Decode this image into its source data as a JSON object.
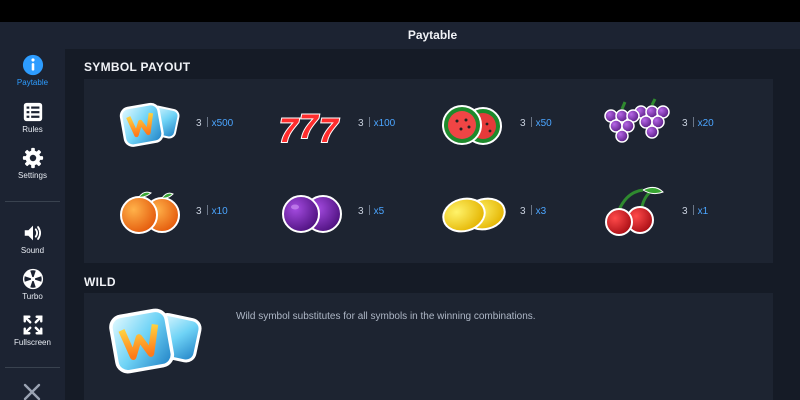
{
  "sidebar": {
    "items": [
      {
        "label": "Paytable",
        "icon": "info-icon",
        "active": true
      },
      {
        "label": "Rules",
        "icon": "list-icon"
      },
      {
        "label": "Settings",
        "icon": "gear-icon"
      },
      {
        "label": "Sound",
        "icon": "speaker-icon"
      },
      {
        "label": "Turbo",
        "icon": "turbo-icon"
      },
      {
        "label": "Fullscreen",
        "icon": "fullscreen-icon"
      }
    ],
    "close_icon": "close-icon"
  },
  "header": {
    "title": "Paytable"
  },
  "symbol_payout": {
    "title": "SYMBOL PAYOUT",
    "rows": [
      [
        {
          "symbol": "ice-wild-icon",
          "count": "3",
          "multiplier": "x500"
        },
        {
          "symbol": "sevens-icon",
          "count": "3",
          "multiplier": "x100"
        },
        {
          "symbol": "watermelon-icon",
          "count": "3",
          "multiplier": "x50"
        },
        {
          "symbol": "grapes-icon",
          "count": "3",
          "multiplier": "x20"
        }
      ],
      [
        {
          "symbol": "orange-icon",
          "count": "3",
          "multiplier": "x10"
        },
        {
          "symbol": "plum-icon",
          "count": "3",
          "multiplier": "x5"
        },
        {
          "symbol": "lemon-icon",
          "count": "3",
          "multiplier": "x3"
        },
        {
          "symbol": "cherry-icon",
          "count": "3",
          "multiplier": "x1"
        }
      ]
    ]
  },
  "wild": {
    "title": "WILD",
    "symbol": "ice-wild-icon",
    "description": "Wild symbol substitutes for all symbols in the winning combinations."
  },
  "colors": {
    "accent": "#2d9cff",
    "multiplier": "#4ba5ff",
    "sidebar": "#1c2332",
    "panel": "#1d2431",
    "background": "#151b26"
  }
}
